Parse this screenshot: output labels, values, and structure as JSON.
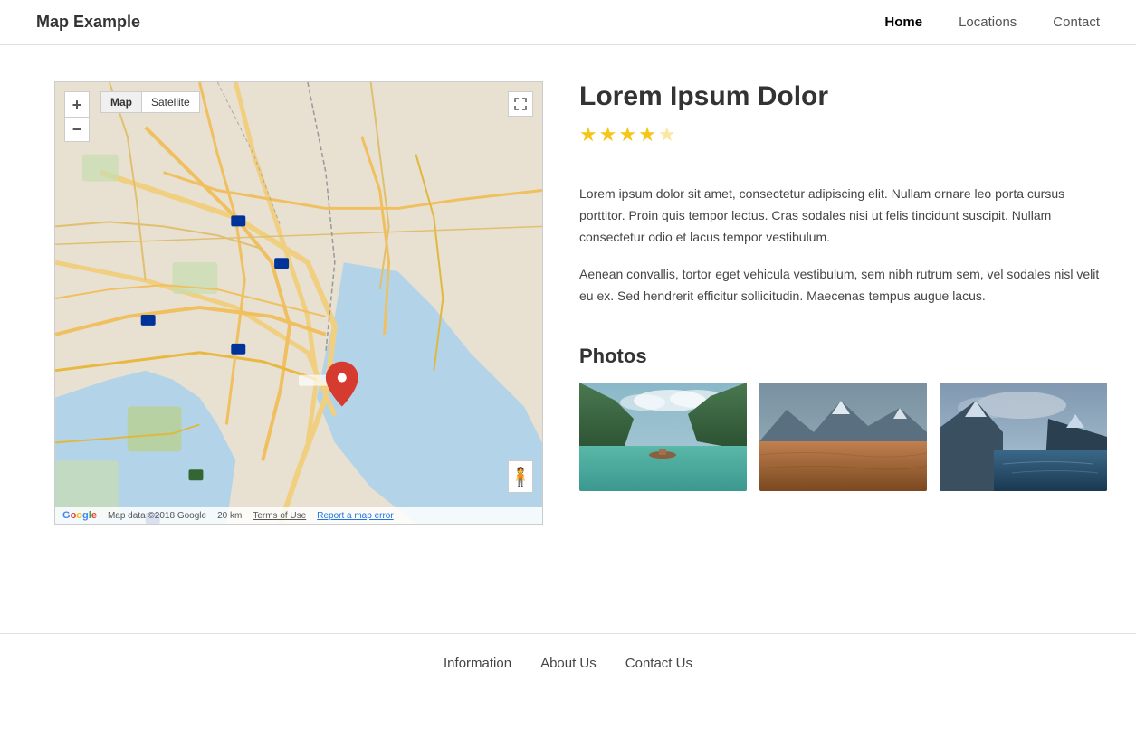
{
  "nav": {
    "brand": "Map Example",
    "links": [
      {
        "label": "Home",
        "active": true
      },
      {
        "label": "Locations",
        "active": false
      },
      {
        "label": "Contact",
        "active": false
      }
    ]
  },
  "map": {
    "zoom_in": "+",
    "zoom_out": "−",
    "type_map": "Map",
    "type_satellite": "Satellite",
    "footer_data": "Map data ©2018 Google",
    "footer_scale": "20 km",
    "footer_terms": "Terms of Use",
    "footer_report": "Report a map error"
  },
  "info": {
    "title": "Lorem Ipsum Dolor",
    "rating": 4,
    "max_rating": 5,
    "paragraph1": "Lorem ipsum dolor sit amet, consectetur adipiscing elit. Nullam ornare leo porta cursus porttitor. Proin quis tempor lectus. Cras sodales nisi ut felis tincidunt suscipit. Nullam consectetur odio et lacus tempor vestibulum.",
    "paragraph2": "Aenean convallis, tortor eget vehicula vestibulum, sem nibh rutrum sem, vel sodales nisl velit eu ex. Sed hendrerit efficitur sollicitudin. Maecenas tempus augue lacus.",
    "photos_label": "Photos"
  },
  "footer": {
    "links": [
      {
        "label": "Information"
      },
      {
        "label": "About Us"
      },
      {
        "label": "Contact Us"
      }
    ]
  }
}
